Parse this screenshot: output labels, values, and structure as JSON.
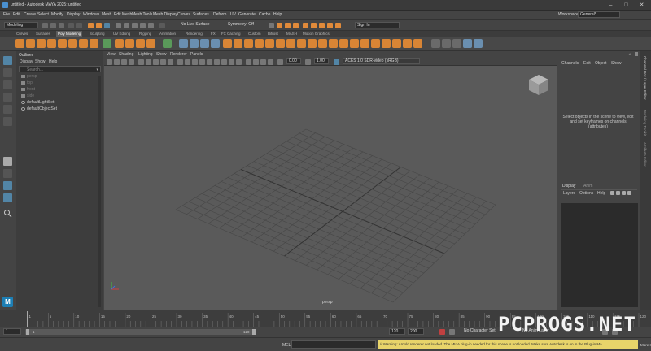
{
  "window": {
    "title": "untitled - Autodesk MAYA 2025: untitled",
    "minimize": "–",
    "maximize": "□",
    "close": "✕"
  },
  "menubar": {
    "items": [
      "File",
      "Edit",
      "Create",
      "Select",
      "Modify",
      "Display",
      "Windows",
      "Mesh",
      "Edit Mesh",
      "Mesh Tools",
      "Mesh Display",
      "Curves",
      "Surfaces",
      "Deform",
      "UV",
      "Generate",
      "Cache",
      "Help"
    ],
    "workspace_label": "Workspace:",
    "workspace_value": "General*"
  },
  "statusline": {
    "mode": "Modeling",
    "live_surface": "No Live Surface",
    "symmetry": "Symmetry: Off",
    "signin": "Sign In"
  },
  "shelf": {
    "tabs": [
      "Curves",
      "Surfaces",
      "Poly Modeling",
      "Sculpting",
      "UV Editing",
      "Rigging",
      "Animation",
      "Rendering",
      "FX",
      "FX Caching",
      "Custom",
      "Bifrost",
      "MASH",
      "Motion Graphics"
    ],
    "active_tab": "Poly Modeling"
  },
  "outliner": {
    "title": "Outliner",
    "menu": [
      "Display",
      "Show",
      "Help"
    ],
    "search_placeholder": "Search...",
    "items": [
      "persp",
      "top",
      "front",
      "side",
      "defaultLightSet",
      "defaultObjectSet"
    ]
  },
  "viewport": {
    "menu": [
      "View",
      "Shading",
      "Lighting",
      "Show",
      "Renderer",
      "Panels"
    ],
    "near": "0.00",
    "scale": "1.00",
    "colorspace": "ACES 1.0 SDR-video (sRGB)",
    "camera_label": "persp"
  },
  "channelbox": {
    "menu": [
      "Channels",
      "Edit",
      "Object",
      "Show"
    ],
    "message": "Select objects in the scene to view, edit and set keyframes on channels (attributes)",
    "side_tabs": [
      "Channel Box / Layer Editor",
      "Modeling Toolkit",
      "Attribute Editor"
    ],
    "layer_tabs": [
      "Display",
      "Anim"
    ],
    "layer_menu": [
      "Layers",
      "Options",
      "Help"
    ]
  },
  "timeline": {
    "ticks": [
      "1",
      "5",
      "10",
      "15",
      "20",
      "25",
      "30",
      "35",
      "40",
      "45",
      "50",
      "55",
      "60",
      "65",
      "70",
      "75",
      "80",
      "85",
      "90",
      "95",
      "100",
      "105",
      "110",
      "115",
      "120"
    ]
  },
  "range": {
    "start": "1",
    "inner_start": "1",
    "inner_end": "120",
    "end": "120",
    "outer_end": "200",
    "character_set": "No Character Set",
    "anim_layer": "No Anim Layer"
  },
  "cmdline": {
    "lang": "MEL",
    "warning": "// Warning: Arnold renderer not loaded. The MtoA plug-in needed for this scene is not loaded. Make sure Autodesk is on in the Plug-in Ma",
    "more": "More Info"
  },
  "watermark": "PCPROGS.NET",
  "colors": {
    "accent": "#e08a3a",
    "selection": "#5285a6",
    "warning": "#e8d46a"
  }
}
